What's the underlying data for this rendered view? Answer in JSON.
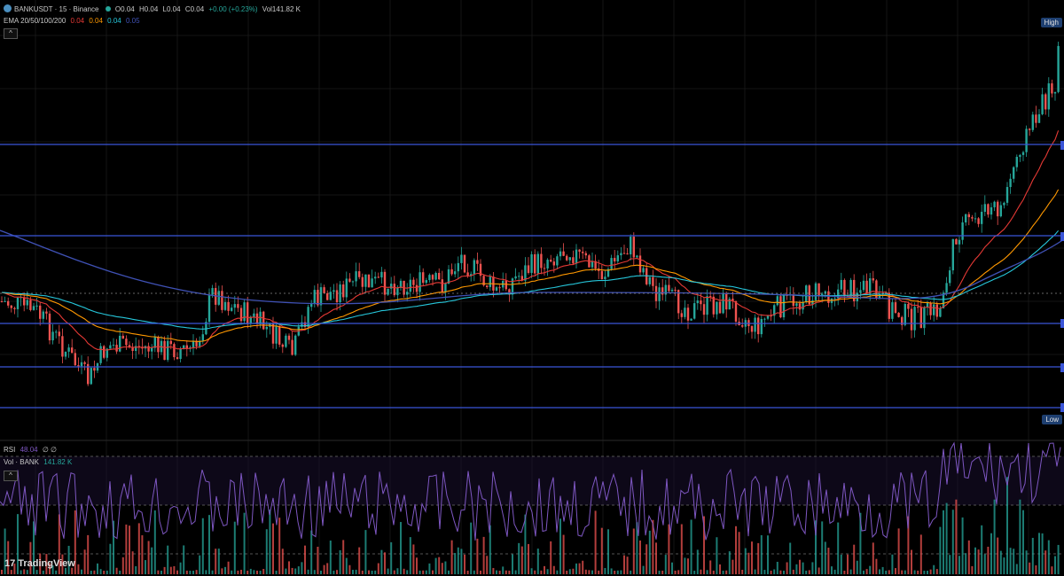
{
  "header": {
    "symbol": "BANKUSDT · 15 · Binance",
    "open": "O0.04",
    "high": "H0.04",
    "low": "L0.04",
    "close": "C0.04",
    "change": "+0.00 (+0.23%)",
    "volume": "Vol141.82 K"
  },
  "ema": {
    "label": "EMA 20/50/100/200",
    "v20": "0.04",
    "v50": "0.04",
    "v100": "0.04",
    "v200": "0.05"
  },
  "rsi": {
    "label": "RSI",
    "value": "48.04",
    "extra": "∅ ∅"
  },
  "vol": {
    "label": "Vol · BANK",
    "value": "141.82 K"
  },
  "price_scale": {
    "high_label": "High",
    "low_label": "Low"
  },
  "brand": {
    "mark": "17",
    "name": "TradingView"
  },
  "colors": {
    "up": "#26a69a",
    "down": "#ef5350",
    "ema20": "#e53935",
    "ema50": "#ff9800",
    "ema100": "#26c6da",
    "ema200": "#3f51b5",
    "hline": "#3a55d8",
    "rsi": "#7e57c2"
  },
  "chart_data": {
    "type": "candlestick",
    "horizontal_levels": [
      "resistance-high",
      "resistance-mid",
      "support-1",
      "support-2",
      "support-low"
    ],
    "indicators": [
      "EMA 20",
      "EMA 50",
      "EMA 100",
      "EMA 200",
      "RSI",
      "Volume"
    ]
  }
}
